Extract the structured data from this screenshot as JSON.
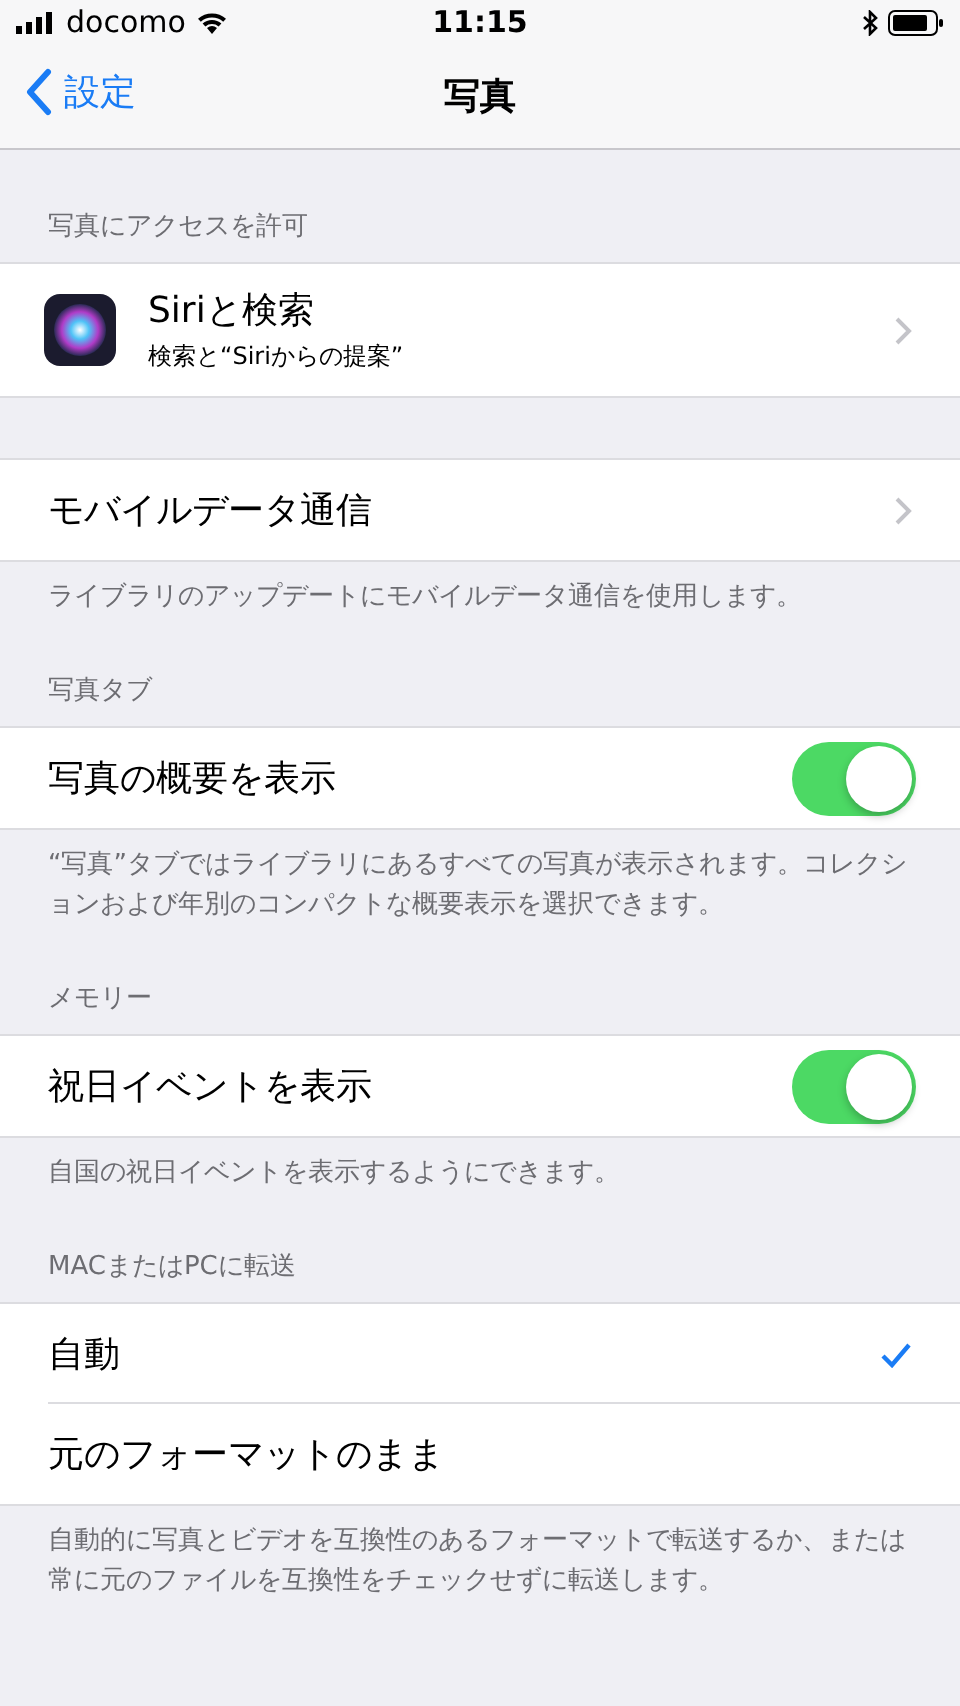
{
  "status_bar": {
    "carrier": "docomo",
    "time": "11:15"
  },
  "nav": {
    "back": "設定",
    "title": "写真"
  },
  "sections": [
    {
      "header": "写真にアクセスを許可",
      "rows": [
        {
          "kind": "app",
          "title": "Siriと検索",
          "subtitle": "検索と“Siriからの提案”"
        }
      ]
    },
    {
      "rows": [
        {
          "kind": "link",
          "title": "モバイルデータ通信"
        }
      ],
      "footer": "ライブラリのアップデートにモバイルデータ通信を使用します。"
    },
    {
      "header": "写真タブ",
      "rows": [
        {
          "kind": "toggle",
          "title": "写真の概要を表示",
          "on": true
        }
      ],
      "footer": "“写真”タブではライブラリにあるすべての写真が表示されます。コレクションおよび年別のコンパクトな概要表示を選択できます。"
    },
    {
      "header": "メモリー",
      "rows": [
        {
          "kind": "toggle",
          "title": "祝日イベントを表示",
          "on": true
        }
      ],
      "footer": "自国の祝日イベントを表示するようにできます。"
    },
    {
      "header": "MACまたはPCに転送",
      "rows": [
        {
          "kind": "check",
          "title": "自動",
          "selected": true
        },
        {
          "kind": "check",
          "title": "元のフォーマットのまま",
          "selected": false
        }
      ],
      "footer": "自動的に写真とビデオを互換性のあるフォーマットで転送するか、または常に元のファイルを互換性をチェックせずに転送します。"
    }
  ]
}
